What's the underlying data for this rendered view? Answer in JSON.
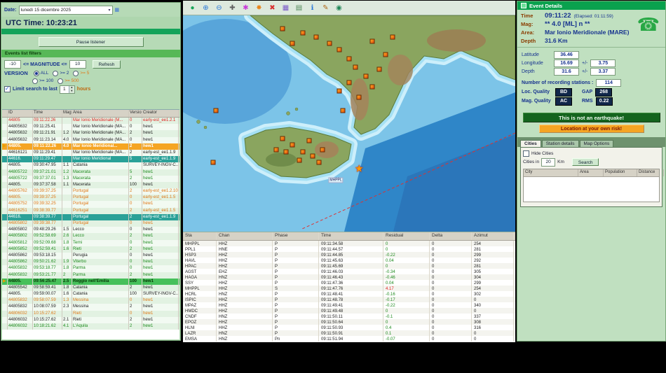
{
  "colors": {
    "accent_green": "#0aa14e",
    "panel_green": "#b6dab6",
    "selection_orange": "#f5a523",
    "selection_teal": "#2aa198",
    "alert_red": "#e02020",
    "navy_text": "#17338f"
  },
  "left_panel": {
    "date_label": "Date:",
    "date_value": "lunedì 15 dicembre 2025",
    "utc_time": "UTC Time: 10:23:21",
    "pause_button": "Pause listener",
    "filters_title": "Events list filters",
    "mag_min": "-10",
    "mag_label": "<= MAGNITUDE <=",
    "mag_max": "10",
    "refresh_button": "Refresh",
    "version_label": "VERSION",
    "version_options": [
      "ALL",
      ">= 2",
      ">= 5",
      ">= 100",
      ">= 500"
    ],
    "limit_label": "Limit search to last",
    "limit_value": "1",
    "limit_suffix": "hours",
    "events_table": {
      "headers": [
        "",
        "ID",
        "Time",
        "Mag",
        "Area",
        "Version",
        "Creator"
      ],
      "rows": [
        {
          "sel": "",
          "id": "44805",
          "time": "09:11:22.26",
          "mag": "",
          "area": "Mar Ionio Meridionale (M...",
          "ver": "0",
          "creator": "early-est_ee1.2.1",
          "state": "alert"
        },
        {
          "sel": "",
          "id": "44805632",
          "time": "09:11:25.41",
          "mag": "",
          "area": "Mar Ionio Meridionale (MA...",
          "ver": "0",
          "creator": "hew1",
          "state": "normal"
        },
        {
          "sel": "",
          "id": "44805632",
          "time": "09:11:21.91",
          "mag": "1.2",
          "area": "Mar Ionio Meridionale (MA...",
          "ver": "2",
          "creator": "hew1",
          "state": "normal"
        },
        {
          "sel": "",
          "id": "44805632",
          "time": "09:11:23.14",
          "mag": "4.0",
          "area": "Mar Ionio Meridionale (MA...",
          "ver": "0",
          "creator": "hew1",
          "state": "normal"
        },
        {
          "sel": "▶",
          "id": "44805.",
          "time": "09:11:22.26",
          "mag": "4.0",
          "area": "Mar Ionio Meridional...",
          "ver": "2",
          "creator": "hew1",
          "state": "sel-orange"
        },
        {
          "sel": "",
          "id": "44616121",
          "time": "09:11:29.41",
          "mag": "",
          "area": "Mar Ionio Meridionale (MA...",
          "ver": "2",
          "creator": "early-est_ee1.1.9",
          "state": "normal"
        },
        {
          "sel": "",
          "id": "44616.",
          "time": "09:11:29.47",
          "mag": "",
          "area": "Mar Ionio Meridional",
          "ver": "5",
          "creator": "early-est_ee1.1.9",
          "state": "sel-teal"
        },
        {
          "sel": "",
          "id": "44805.",
          "time": "09:30:47.95",
          "mag": "1.1",
          "area": "Catania",
          "ver": "",
          "creator": "SURVEY-INGV-C...",
          "state": "normal"
        },
        {
          "sel": "",
          "id": "44805722",
          "time": "09:37:21.01",
          "mag": "1.2",
          "area": "Macerata",
          "ver": "5",
          "creator": "hew1",
          "state": "green"
        },
        {
          "sel": "",
          "id": "44805722",
          "time": "09:37:37.01",
          "mag": "1.3",
          "area": "Macerata",
          "ver": "2",
          "creator": "hew1",
          "state": "green"
        },
        {
          "sel": "",
          "id": "44805.",
          "time": "09:37:37.58",
          "mag": "1.1",
          "area": "Macerata",
          "ver": "100",
          "creator": "hew1",
          "state": "normal"
        },
        {
          "sel": "",
          "id": "44805762",
          "time": "09:39:37.25",
          "mag": "",
          "area": "Portugal",
          "ver": "2",
          "creator": "early-est_ee1.2.10",
          "state": "orange"
        },
        {
          "sel": "",
          "id": "44805.",
          "time": "09:39:37.25",
          "mag": "",
          "area": "Portugal",
          "ver": "0",
          "creator": "early-est_ee1.1.5",
          "state": "orange"
        },
        {
          "sel": "",
          "id": "44805752",
          "time": "09:39:32.25",
          "mag": "",
          "area": "Portugal",
          "ver": "0",
          "creator": "hew1",
          "state": "orange"
        },
        {
          "sel": "",
          "id": "44616251",
          "time": "09:38:39.77",
          "mag": "",
          "area": "Portugal",
          "ver": "2",
          "creator": "early-est_ee1.1.5",
          "state": "orange"
        },
        {
          "sel": "",
          "id": "44616.",
          "time": "09:38:39.77",
          "mag": "",
          "area": "Portugal",
          "ver": "2",
          "creator": "early-est_ee1.1.9",
          "state": "sel-teal"
        },
        {
          "sel": "",
          "id": "44805802",
          "time": "09:39:38.77",
          "mag": "",
          "area": "Portugal",
          "ver": "0",
          "creator": "hew1",
          "state": "orange"
        },
        {
          "sel": "",
          "id": "44805802",
          "time": "09:48:29.26",
          "mag": "1.5",
          "area": "Lecco",
          "ver": "0",
          "creator": "hew1",
          "state": "normal"
        },
        {
          "sel": "",
          "id": "44805802",
          "time": "09:52:58.69",
          "mag": "2.6",
          "area": "Lecco",
          "ver": "2",
          "creator": "hew1",
          "state": "green"
        },
        {
          "sel": "",
          "id": "44805812",
          "time": "09:52:09.68",
          "mag": "1.8",
          "area": "Terni",
          "ver": "0",
          "creator": "hew1",
          "state": "green"
        },
        {
          "sel": "",
          "id": "44805852",
          "time": "09:52:59.41",
          "mag": "1.6",
          "area": "Rieti",
          "ver": "2",
          "creator": "hew1",
          "state": "green"
        },
        {
          "sel": "",
          "id": "44805862",
          "time": "09:53:18.15",
          "mag": "",
          "area": "Perugia",
          "ver": "0",
          "creator": "hew1",
          "state": "normal"
        },
        {
          "sel": "",
          "id": "44805862",
          "time": "09:50:21.62",
          "mag": "1.9",
          "area": "Viterbo",
          "ver": "0",
          "creator": "hew1",
          "state": "green"
        },
        {
          "sel": "",
          "id": "44805832",
          "time": "09:53:18.77",
          "mag": "1.8",
          "area": "Parma",
          "ver": "0",
          "creator": "hew1",
          "state": "green"
        },
        {
          "sel": "",
          "id": "44805832",
          "time": "09:53:21.77",
          "mag": "2",
          "area": "Parma",
          "ver": "2",
          "creator": "hew1",
          "state": "green"
        },
        {
          "sel": "▶",
          "id": "44805.",
          "time": "09:56:25.47",
          "mag": "2.5",
          "area": "Reggio nell'Emilia",
          "ver": "100",
          "creator": "hew1",
          "state": "sel-green"
        },
        {
          "sel": "",
          "id": "44805542",
          "time": "09:58:59.41",
          "mag": "1.8",
          "area": "Catania",
          "ver": "2",
          "creator": "hew1",
          "state": "normal"
        },
        {
          "sel": "",
          "id": "44805.",
          "time": "09:59:00.07",
          "mag": "1.6",
          "area": "Catania",
          "ver": "100",
          "creator": "SURVEY-INGV-C...",
          "state": "normal"
        },
        {
          "sel": "",
          "id": "44805832",
          "time": "09:58:07.59",
          "mag": "1.3",
          "area": "Messina",
          "ver": "0",
          "creator": "hew1",
          "state": "orange"
        },
        {
          "sel": "",
          "id": "44805832",
          "time": "10:08:07.59",
          "mag": "2.3",
          "area": "Messina",
          "ver": "2",
          "creator": "hew1",
          "state": "normal"
        },
        {
          "sel": "",
          "id": "44806032",
          "time": "10:15:27.62",
          "mag": "",
          "area": "Rieti",
          "ver": "0",
          "creator": "hew1",
          "state": "orange"
        },
        {
          "sel": "",
          "id": "44806032",
          "time": "10:15:27.62",
          "mag": "2.1",
          "area": "Rieti",
          "ver": "2",
          "creator": "hew1",
          "state": "normal"
        },
        {
          "sel": "",
          "id": "44806032",
          "time": "10:18:21.62",
          "mag": "4.1",
          "area": "L'Aquila",
          "ver": "2",
          "creator": "hew1",
          "state": "green"
        }
      ]
    }
  },
  "map_panel": {
    "toolbar": [
      {
        "glyph": "●"
      },
      {
        "glyph": "⊕"
      },
      {
        "glyph": "⊖"
      },
      {
        "glyph": "✚"
      },
      {
        "glyph": "✱"
      },
      {
        "glyph": "✸"
      },
      {
        "glyph": "✖"
      },
      {
        "glyph": "▦"
      },
      {
        "glyph": "▤"
      },
      {
        "glyph": "ℹ"
      },
      {
        "glyph": "✎"
      },
      {
        "glyph": "◉"
      }
    ],
    "markers": [
      {
        "x": 30,
        "y": 6,
        "type": "quake",
        "label": ""
      },
      {
        "x": 33,
        "y": 13,
        "type": "quake",
        "label": ""
      },
      {
        "x": 36,
        "y": 8,
        "type": "quake",
        "label": ""
      },
      {
        "x": 40,
        "y": 10,
        "type": "quake",
        "label": ""
      },
      {
        "x": 44,
        "y": 13,
        "type": "quake",
        "label": ""
      },
      {
        "x": 47,
        "y": 16,
        "type": "quake",
        "label": ""
      },
      {
        "x": 50,
        "y": 20,
        "type": "quake",
        "label": ""
      },
      {
        "x": 52,
        "y": 24,
        "type": "quake",
        "label": ""
      },
      {
        "x": 55,
        "y": 28,
        "type": "quake",
        "label": ""
      },
      {
        "x": 50,
        "y": 31,
        "type": "quake",
        "label": ""
      },
      {
        "x": 47,
        "y": 35,
        "type": "quake",
        "label": ""
      },
      {
        "x": 53,
        "y": 38,
        "type": "quake",
        "label": ""
      },
      {
        "x": 57,
        "y": 33,
        "type": "quake",
        "label": ""
      },
      {
        "x": 59,
        "y": 25,
        "type": "quake",
        "label": ""
      },
      {
        "x": 61,
        "y": 18,
        "type": "quake",
        "label": ""
      },
      {
        "x": 57,
        "y": 12,
        "type": "quake",
        "label": ""
      },
      {
        "x": 63,
        "y": 10,
        "type": "quake",
        "label": ""
      },
      {
        "x": 48,
        "y": 44,
        "type": "quake",
        "label": ""
      },
      {
        "x": 28,
        "y": 62,
        "type": "quake",
        "label": ""
      },
      {
        "x": 30,
        "y": 57,
        "type": "quake",
        "label": ""
      },
      {
        "x": 33,
        "y": 60,
        "type": "quake",
        "label": ""
      },
      {
        "x": 36,
        "y": 63,
        "type": "quake",
        "label": ""
      },
      {
        "x": 39,
        "y": 65,
        "type": "quake",
        "label": ""
      },
      {
        "x": 35,
        "y": 67,
        "type": "quake",
        "label": ""
      },
      {
        "x": 31,
        "y": 63,
        "type": "quake",
        "label": ""
      },
      {
        "x": 38,
        "y": 58,
        "type": "quake",
        "label": ""
      },
      {
        "x": 42,
        "y": 62,
        "type": "quake",
        "label": ""
      },
      {
        "x": 41,
        "y": 68,
        "type": "quake",
        "label": ""
      },
      {
        "x": 10,
        "y": 44,
        "type": "quake",
        "label": ""
      },
      {
        "x": 9,
        "y": 68,
        "type": "quake",
        "label": ""
      },
      {
        "x": 53,
        "y": 71,
        "type": "star",
        "label": "★"
      },
      {
        "x": 46,
        "y": 76,
        "type": "label",
        "label": "MHPPL"
      }
    ],
    "picks_table": {
      "headers": [
        "Sta",
        "Chan",
        "Phase",
        "Time",
        "Residual",
        "Delta",
        "Azimut"
      ],
      "rows": [
        {
          "sta": "MHPPL",
          "chan": "HHZ",
          "phase": "P",
          "time": "09:11:34.58",
          "res": "0",
          "res_state": "ok",
          "delta": "0",
          "az": "254"
        },
        {
          "sta": "PPL1",
          "chan": "HNE",
          "phase": "P",
          "time": "09:11:44.57",
          "res": "0",
          "res_state": "ok",
          "delta": "0",
          "az": "281"
        },
        {
          "sta": "HSP3",
          "chan": "HHZ",
          "phase": "P",
          "time": "09:11:44.85",
          "res": "-0.22",
          "res_state": "ok",
          "delta": "0",
          "az": "299"
        },
        {
          "sta": "HAVL",
          "chan": "HHZ",
          "phase": "P",
          "time": "09:11:45.63",
          "res": "0.04",
          "res_state": "ok",
          "delta": "0",
          "az": "292"
        },
        {
          "sta": "HPAC",
          "chan": "HHZ",
          "phase": "P",
          "time": "09:11:45.69",
          "res": "0",
          "res_state": "ok",
          "delta": "0",
          "az": "281"
        },
        {
          "sta": "AGST",
          "chan": "EHZ",
          "phase": "P",
          "time": "09:11:46.03",
          "res": "-0.34",
          "res_state": "ok",
          "delta": "0",
          "az": "305"
        },
        {
          "sta": "HAGA",
          "chan": "HNZ",
          "phase": "P",
          "time": "09:11:46.43",
          "res": "-0.46",
          "res_state": "ok",
          "delta": "0",
          "az": "304"
        },
        {
          "sta": "SSY",
          "chan": "HHZ",
          "phase": "P",
          "time": "09:11:47.36",
          "res": "0.04",
          "res_state": "ok",
          "delta": "0",
          "az": "299"
        },
        {
          "sta": "MHPPL",
          "chan": "HHZ",
          "phase": "S",
          "time": "09:11:47.76",
          "res": "4.17",
          "res_state": "hi",
          "delta": "0",
          "az": "254"
        },
        {
          "sta": "HCRL",
          "chan": "HNZ",
          "phase": "P",
          "time": "09:11:48.41",
          "res": "-0.16",
          "res_state": "ok",
          "delta": "0",
          "az": "302"
        },
        {
          "sta": "ISPIC",
          "chan": "HHZ",
          "phase": "P",
          "time": "09:11:48.78",
          "res": "-0.17",
          "res_state": "ok",
          "delta": "0",
          "az": "0"
        },
        {
          "sta": "MPAZ",
          "chan": "HHZ",
          "phase": "P",
          "time": "09:11:49.41",
          "res": "-0.22",
          "res_state": "ok",
          "delta": "0",
          "az": "340"
        },
        {
          "sta": "HMDC",
          "chan": "HHZ",
          "phase": "P",
          "time": "09:11:49.48",
          "res": "0",
          "res_state": "ok",
          "delta": "0",
          "az": "0"
        },
        {
          "sta": "CNDF",
          "chan": "HNZ",
          "phase": "P",
          "time": "09:11:50.11",
          "res": "-0.1",
          "res_state": "ok",
          "delta": "0",
          "az": "337"
        },
        {
          "sta": "EPOZ",
          "chan": "HHZ",
          "phase": "P",
          "time": "09:11:50.64",
          "res": "0",
          "res_state": "ok",
          "delta": "0",
          "az": "308"
        },
        {
          "sta": "HLNI",
          "chan": "HHZ",
          "phase": "P",
          "time": "09:11:50.93",
          "res": "0.4",
          "res_state": "ok",
          "delta": "0",
          "az": "316"
        },
        {
          "sta": "LAZR",
          "chan": "HNZ",
          "phase": "P",
          "time": "09:11:50.91",
          "res": "0.1",
          "res_state": "ok",
          "delta": "0",
          "az": "0"
        },
        {
          "sta": "EMSA",
          "chan": "HNZ",
          "phase": "Pn",
          "time": "09:11:51.94",
          "res": "-0.07",
          "res_state": "ok",
          "delta": "0",
          "az": "0"
        }
      ]
    }
  },
  "right_panel": {
    "header": "Event Details",
    "time_label": "Time",
    "time_value": "09:11:22",
    "elapsed": "(Elapsed: 01:11:59)",
    "mag_label": "Mag:",
    "mag_value": "** 4.0 [ML] n **",
    "area_label": "Area:",
    "area_value": "Mar Ionio Meridionale (MARE)",
    "depth_label": "Depth",
    "depth_value": "31.6 Km",
    "phone_icon": "☎",
    "fields": {
      "latitude_label": "Latitude",
      "latitude": "36.46",
      "longitude_label": "Longitude",
      "longitude": "16.69",
      "pm": "+/-",
      "longitude_err": "3.75",
      "depth_label": "Depth",
      "depth": "31.6",
      "depth_err": "3.37",
      "stations_label": "Number of recording stations :",
      "stations": "114",
      "loc_quality_label": "Loc. Quality",
      "loc_quality": "BD",
      "gap_label": "GAP",
      "gap": "268",
      "mag_quality_label": "Mag. Quality",
      "mag_quality": "AC",
      "rms_label": "RMS",
      "rms": "0.22"
    },
    "not_earthquake_button": "This is not an earthquake!",
    "risk_button": "Location at your own risk!",
    "tabs": [
      "Cities",
      "Station details",
      "Map Options"
    ],
    "cities": {
      "hide_cities_label": "Hide Cities",
      "cities_in_label": "Cities in",
      "radius": "20",
      "km_label": "Km",
      "search_button": "Search",
      "headers": [
        "City",
        "Area",
        "Population",
        "Distance"
      ]
    }
  }
}
